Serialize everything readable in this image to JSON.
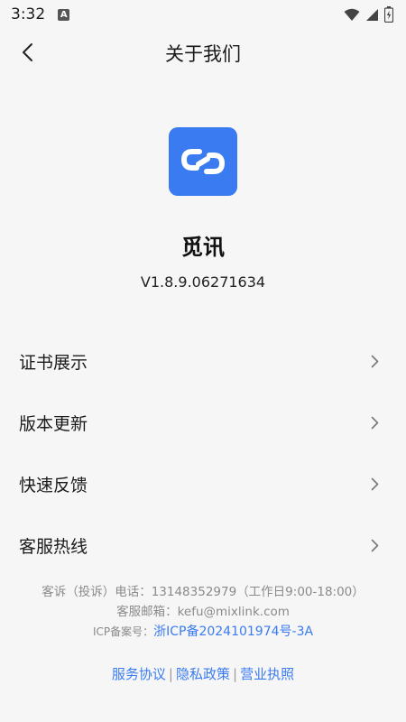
{
  "status_bar": {
    "time": "3:32",
    "app_icon_letter": "A",
    "icons": [
      "wifi-icon",
      "signal-icon",
      "battery-icon"
    ]
  },
  "header": {
    "title": "关于我们",
    "back_icon": "chevron-left-icon"
  },
  "app": {
    "name": "觅讯",
    "version": "V1.8.9.06271634",
    "logo_color": "#3a7bf2",
    "logo_icon": "link-icon"
  },
  "menu": {
    "items": [
      {
        "label": "证书展示"
      },
      {
        "label": "版本更新"
      },
      {
        "label": "快速反馈"
      },
      {
        "label": "客服热线"
      }
    ]
  },
  "footer": {
    "complaint_line": "客诉（投诉）电话：13148352979（工作日9:00-18:00）",
    "email_line": "客服邮箱：kefu@mixlink.com",
    "icp_prefix": "ICP备案号：",
    "icp_number": "浙ICP备2024101974号-3A"
  },
  "links": {
    "service_agreement": "服务协议",
    "separator": "|",
    "privacy_policy": "隐私政策",
    "business_license": "营业执照"
  },
  "colors": {
    "accent": "#3a7bf2",
    "background": "#f6f6f6",
    "muted_text": "#8a8a8a"
  }
}
